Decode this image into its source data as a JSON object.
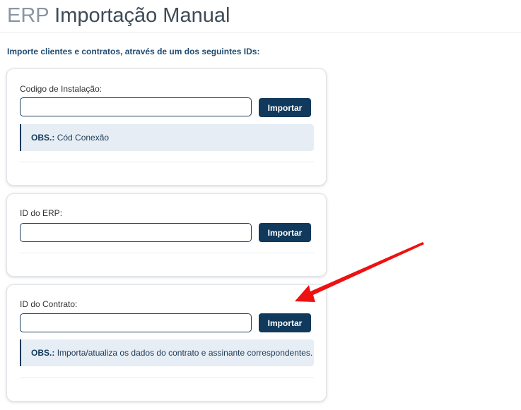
{
  "header": {
    "title_prefix": "ERP",
    "title_main": "Importação Manual"
  },
  "intro_text": "Importe clientes e contratos, através de um dos seguintes IDs:",
  "cards": [
    {
      "label": "Codigo de Instalação:",
      "input_value": "",
      "button_label": "Importar",
      "obs_key": "OBS.:",
      "obs_text": "Cód Conexão"
    },
    {
      "label": "ID do ERP:",
      "input_value": "",
      "button_label": "Importar"
    },
    {
      "label": "ID do Contrato:",
      "input_value": "",
      "button_label": "Importar",
      "obs_key": "OBS.:",
      "obs_text": "Importa/atualiza os dados do contrato e assinante correspondentes."
    }
  ],
  "colors": {
    "primary": "#10395c",
    "obs_background": "#e6edf5",
    "annotation_arrow": "#ee1111"
  }
}
